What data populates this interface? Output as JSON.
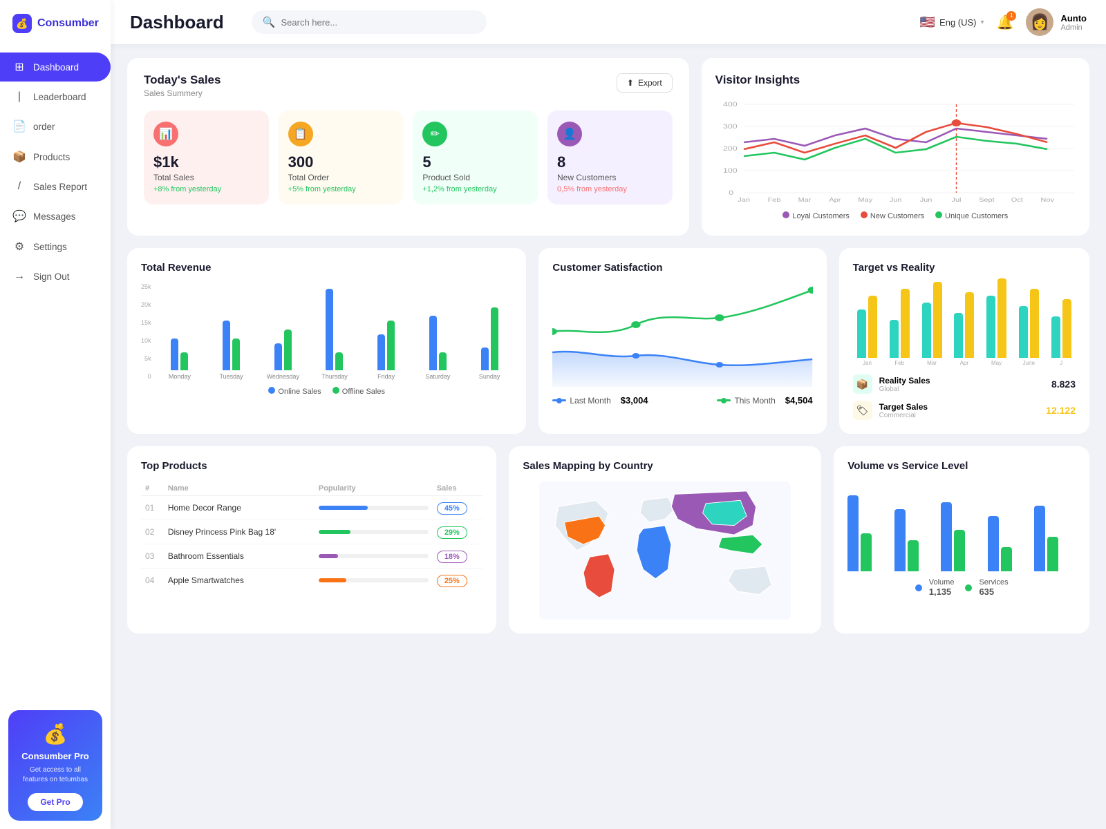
{
  "brand": {
    "name": "Consumber",
    "icon": "💰"
  },
  "sidebar": {
    "items": [
      {
        "id": "dashboard",
        "label": "Dashboard",
        "icon": "⊞",
        "active": true
      },
      {
        "id": "leaderboard",
        "label": "Leaderboard",
        "icon": "🏆",
        "active": false
      },
      {
        "id": "order",
        "label": "order",
        "icon": "📄",
        "active": false
      },
      {
        "id": "products",
        "label": "Products",
        "icon": "📦",
        "active": false
      },
      {
        "id": "sales-report",
        "label": "Sales Report",
        "icon": "📊",
        "active": false
      },
      {
        "id": "messages",
        "label": "Messages",
        "icon": "💬",
        "active": false
      },
      {
        "id": "settings",
        "label": "Settings",
        "icon": "⚙",
        "active": false
      },
      {
        "id": "signout",
        "label": "Sign Out",
        "icon": "→",
        "active": false
      }
    ],
    "pro": {
      "icon": "💰",
      "title": "Consumber Pro",
      "desc": "Get access to all features on tetumbas",
      "btn_label": "Get Pro"
    }
  },
  "header": {
    "title": "Dashboard",
    "search_placeholder": "Search here...",
    "lang": "Eng (US)",
    "user": {
      "name": "Aunto",
      "role": "Admin"
    }
  },
  "todays_sales": {
    "title": "Today's Sales",
    "subtitle": "Sales Summery",
    "export_label": "Export",
    "stats": [
      {
        "value": "$1k",
        "label": "Total Sales",
        "change": "+8% from yesterday",
        "pos": true,
        "color": "pink"
      },
      {
        "value": "300",
        "label": "Total Order",
        "change": "+5% from yesterday",
        "pos": true,
        "color": "yellow"
      },
      {
        "value": "5",
        "label": "Product Sold",
        "change": "+1,2% from yesterday",
        "pos": true,
        "color": "green"
      },
      {
        "value": "8",
        "label": "New Customers",
        "change": "0,5% from yesterday",
        "pos": false,
        "color": "purple"
      }
    ]
  },
  "visitor_insights": {
    "title": "Visitor Insights",
    "months": [
      "Jan",
      "Feb",
      "Mar",
      "Apr",
      "May",
      "Jun",
      "Jun",
      "Jul",
      "Sept",
      "Oct",
      "Nov"
    ],
    "legend": [
      {
        "label": "Loyal Customers",
        "color": "#9b59b6"
      },
      {
        "label": "New Customers",
        "color": "#e74c3c"
      },
      {
        "label": "Unique Customers",
        "color": "#22c55e"
      }
    ]
  },
  "total_revenue": {
    "title": "Total Revenue",
    "days": [
      "Monday",
      "Tuesday",
      "Wednesday",
      "Thursday",
      "Friday",
      "Saturday",
      "Sunday"
    ],
    "y_labels": [
      "25k",
      "20k",
      "15k",
      "10k",
      "5k",
      "0"
    ],
    "online": [
      35,
      55,
      30,
      90,
      40,
      60,
      25
    ],
    "offline": [
      20,
      35,
      45,
      20,
      55,
      20,
      70
    ],
    "legend": [
      {
        "label": "Online Sales",
        "color": "#3b82f6"
      },
      {
        "label": "Offline Sales",
        "color": "#22c55e"
      }
    ]
  },
  "customer_satisfaction": {
    "title": "Customer Satisfaction",
    "last_month": {
      "label": "Last Month",
      "value": "$3,004"
    },
    "this_month": {
      "label": "This Month",
      "value": "$4,504"
    }
  },
  "target_vs_reality": {
    "title": "Target vs Reality",
    "months": [
      "Jan",
      "Feb",
      "Mar",
      "Apr",
      "May",
      "June",
      "J"
    ],
    "reality": {
      "label": "Reality Sales",
      "sub": "Global",
      "value": "8.823",
      "color": "#2dd4bf"
    },
    "target": {
      "label": "Target Sales",
      "sub": "Commercial",
      "value": "12.122",
      "color": "#f5c518"
    }
  },
  "top_products": {
    "title": "Top Products",
    "cols": [
      "#",
      "Name",
      "Popularity",
      "Sales"
    ],
    "rows": [
      {
        "num": "01",
        "name": "Home Decor Range",
        "popularity": 45,
        "sales": "45%",
        "bar_color": "#3b82f6",
        "badge_color": "#3b82f6"
      },
      {
        "num": "02",
        "name": "Disney Princess Pink Bag 18'",
        "popularity": 29,
        "sales": "29%",
        "bar_color": "#22c55e",
        "badge_color": "#22c55e"
      },
      {
        "num": "03",
        "name": "Bathroom Essentials",
        "popularity": 18,
        "sales": "18%",
        "bar_color": "#9b59b6",
        "badge_color": "#9b59b6"
      },
      {
        "num": "04",
        "name": "Apple Smartwatches",
        "popularity": 25,
        "sales": "25%",
        "bar_color": "#f97316",
        "badge_color": "#f97316"
      }
    ]
  },
  "sales_map": {
    "title": "Sales Mapping by Country"
  },
  "volume_service": {
    "title": "Volume vs Service Level",
    "legend": [
      {
        "label": "Volume",
        "value": "1,135",
        "color": "#3b82f6"
      },
      {
        "label": "Services",
        "value": "635",
        "color": "#22c55e"
      }
    ]
  }
}
